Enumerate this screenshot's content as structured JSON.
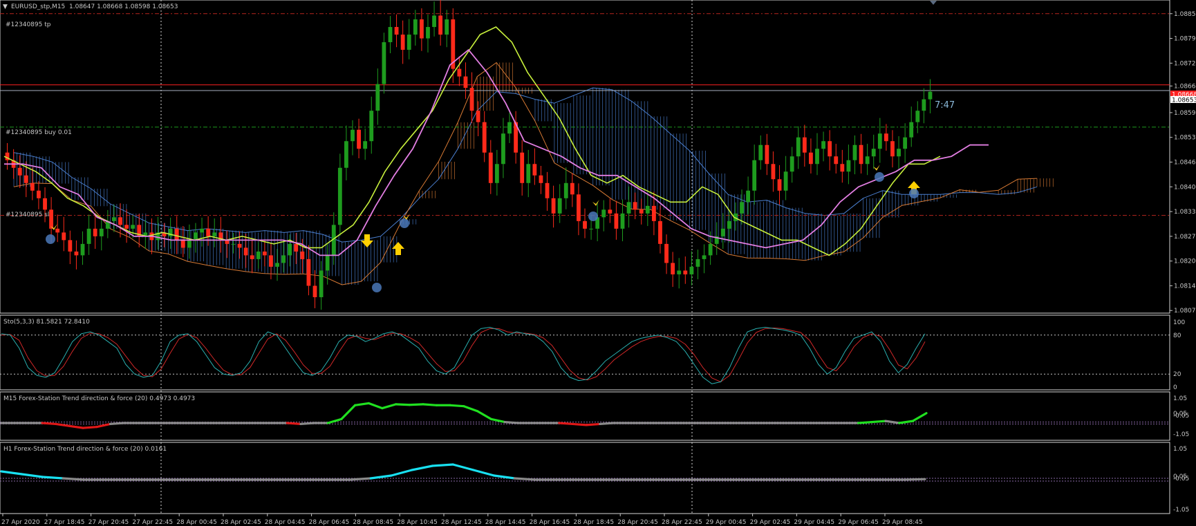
{
  "window": {
    "symbol_title": "EURUSD_stp,M15",
    "ohlc": "1.08647 1.08668 1.08598 1.08653",
    "countdown": "7:47"
  },
  "orders": {
    "tp_label": "#12340895 tp",
    "tp_price": 1.08855,
    "buy_label": "#12340895 buy 0.01",
    "buy_price": 1.08557,
    "sl_label": "#12340895 sl",
    "sl_price": 1.08325
  },
  "price_lines": {
    "ask_price": 1.08668,
    "ask_label": "1.08668",
    "bid_price": 1.08653,
    "bid_label": "1.08653"
  },
  "colors": {
    "bull": "#1e9c1e",
    "bear": "#ff2a1a",
    "tenkan": "#c8f03c",
    "kijun": "#e27ee2",
    "cloud_up": "#4a7fd0",
    "cloud_down": "#d87a34",
    "tp_line": "#b8261e",
    "buy_line": "#1e9c1e",
    "ask_line": "#ff2020",
    "bid_line": "#a8b0c0",
    "sto_main": "#2ab0b0",
    "sto_signal": "#d02828",
    "trend_up": "#20e020",
    "trend_down": "#e01818",
    "trend_flat": "#8a8a8a",
    "h1_up": "#18e0f0",
    "grid": "#c8c8c8"
  },
  "price_axis": {
    "min": 1.0807,
    "max": 1.0888,
    "tick_labels": [
      "1.08855",
      "1.08790",
      "1.08725",
      "1.08665",
      "1.08595",
      "1.08530",
      "1.08465",
      "1.08400",
      "1.08335",
      "1.08270",
      "1.08205",
      "1.08140",
      "1.08075"
    ]
  },
  "time_axis": {
    "labels": [
      "27 Apr 2020",
      "27 Apr 18:45",
      "27 Apr 20:45",
      "27 Apr 22:45",
      "28 Apr 00:45",
      "28 Apr 02:45",
      "28 Apr 04:45",
      "28 Apr 06:45",
      "28 Apr 08:45",
      "28 Apr 10:45",
      "28 Apr 12:45",
      "28 Apr 14:45",
      "28 Apr 16:45",
      "28 Apr 18:45",
      "28 Apr 20:45",
      "28 Apr 22:45",
      "29 Apr 00:45",
      "29 Apr 02:45",
      "29 Apr 04:45",
      "29 Apr 06:45",
      "29 Apr 08:45"
    ]
  },
  "stochastic": {
    "title": "Sto(5,3,3) 81.5821 72.8410",
    "ticks": [
      "100",
      "80",
      "20",
      "0"
    ],
    "levels": [
      80,
      20
    ]
  },
  "trend_m15": {
    "title": "M15 Forex-Station Trend direction & force (20) 0.4973 0.4973",
    "ticks": [
      "1.05",
      "0.05",
      "-0.05",
      "-1.05"
    ]
  },
  "trend_h1": {
    "title": "H1 Forex-Station Trend direction & force (20) 0.0161",
    "ticks": [
      "1.05",
      "0.05",
      "-0.05",
      "-1.05"
    ]
  },
  "chart_data": [
    {
      "type": "candlestick",
      "title": "EURUSD_stp,M15",
      "ylim": [
        1.0807,
        1.0888
      ],
      "x_range": [
        "27 Apr 2020",
        "29 Apr 09:30"
      ],
      "candles_close": [
        1.0847,
        1.0845,
        1.0843,
        1.0841,
        1.0839,
        1.0837,
        1.0834,
        1.0829,
        1.0828,
        1.0826,
        1.0823,
        1.0822,
        1.0825,
        1.0829,
        1.0827,
        1.0829,
        1.0831,
        1.0832,
        1.083,
        1.0829,
        1.083,
        1.0827,
        1.0828,
        1.0826,
        1.0828,
        1.0827,
        1.0829,
        1.0826,
        1.0824,
        1.0826,
        1.0828,
        1.0829,
        1.0827,
        1.0828,
        1.0826,
        1.0825,
        1.0825,
        1.0824,
        1.0822,
        1.0821,
        1.0823,
        1.0822,
        1.0819,
        1.082,
        1.0822,
        1.0825,
        1.0823,
        1.0821,
        1.0814,
        1.0811,
        1.0818,
        1.0822,
        1.083,
        1.0845,
        1.0852,
        1.0855,
        1.085,
        1.0852,
        1.086,
        1.0867,
        1.0878,
        1.0882,
        1.088,
        1.0876,
        1.088,
        1.0884,
        1.0879,
        1.0882,
        1.0885,
        1.088,
        1.0884,
        1.0871,
        1.0869,
        1.0866,
        1.086,
        1.0857,
        1.0849,
        1.0841,
        1.0846,
        1.0854,
        1.0857,
        1.0849,
        1.0841,
        1.0846,
        1.0843,
        1.0841,
        1.0837,
        1.0833,
        1.0837,
        1.0841,
        1.0838,
        1.0831,
        1.0829,
        1.0829,
        1.0832,
        1.0834,
        1.0833,
        1.0829,
        1.0833,
        1.0836,
        1.0834,
        1.0833,
        1.0835,
        1.0831,
        1.0825,
        1.082,
        1.0817,
        1.0818,
        1.0817,
        1.0819,
        1.0821,
        1.0822,
        1.0825,
        1.0827,
        1.0829,
        1.0831,
        1.0833,
        1.0836,
        1.0839,
        1.0847,
        1.0851,
        1.0846,
        1.0842,
        1.0839,
        1.0844,
        1.0848,
        1.0853,
        1.0849,
        1.0846,
        1.085,
        1.0852,
        1.0848,
        1.0846,
        1.0844,
        1.0847,
        1.0851,
        1.0846,
        1.0848,
        1.085,
        1.0854,
        1.0852,
        1.0848,
        1.085,
        1.0853,
        1.0857,
        1.086,
        1.0863,
        1.0865
      ],
      "ichimoku": {
        "tenkan": [
          1.0848,
          1.0846,
          1.0844,
          1.0841,
          1.0837,
          1.0835,
          1.0832,
          1.083,
          1.0828,
          1.0827,
          1.0828,
          1.0827,
          1.0826,
          1.0827,
          1.0826,
          1.0827,
          1.0826,
          1.0825,
          1.0826,
          1.0824,
          1.0824,
          1.0827,
          1.083,
          1.0836,
          1.0844,
          1.085,
          1.0855,
          1.086,
          1.0868,
          1.0874,
          1.088,
          1.0882,
          1.0878,
          1.087,
          1.0864,
          1.0858,
          1.085,
          1.0843,
          1.0841,
          1.0843,
          1.084,
          1.0838,
          1.0836,
          1.0836,
          1.084,
          1.0838,
          1.0832,
          1.083,
          1.0828,
          1.0826,
          1.0826,
          1.0824,
          1.0822,
          1.0825,
          1.0829,
          1.0835,
          1.0841,
          1.0846,
          1.0846,
          1.0848
        ],
        "kijun": [
          1.0846,
          1.0846,
          1.0845,
          1.084,
          1.0838,
          1.0832,
          1.083,
          1.0827,
          1.0827,
          1.0826,
          1.0826,
          1.0826,
          1.0826,
          1.0826,
          1.0826,
          1.0826,
          1.0825,
          1.0822,
          1.0822,
          1.0826,
          1.0835,
          1.0843,
          1.085,
          1.086,
          1.0872,
          1.0876,
          1.087,
          1.0862,
          1.0852,
          1.085,
          1.0848,
          1.0845,
          1.0843,
          1.0843,
          1.084,
          1.0837,
          1.0833,
          1.0829,
          1.0827,
          1.0826,
          1.0825,
          1.0824,
          1.0825,
          1.0826,
          1.083,
          1.0836,
          1.084,
          1.0842,
          1.0844,
          1.0847,
          1.0847,
          1.0848,
          1.0851,
          1.0851
        ]
      }
    },
    {
      "type": "line",
      "title": "Sto(5,3,3) 81.5821 72.8410",
      "ylim": [
        0,
        100
      ],
      "series": [
        {
          "name": "Sto(5,3,3)",
          "values": [
            82,
            80,
            60,
            30,
            18,
            15,
            22,
            45,
            70,
            82,
            85,
            80,
            70,
            60,
            35,
            20,
            15,
            18,
            40,
            70,
            80,
            82,
            70,
            50,
            30,
            20,
            18,
            22,
            40,
            70,
            85,
            80,
            60,
            40,
            22,
            18,
            25,
            45,
            70,
            80,
            78,
            70,
            75,
            82,
            85,
            80,
            70,
            60,
            40,
            25,
            20,
            30,
            55,
            80,
            90,
            92,
            88,
            80,
            85,
            82,
            80,
            70,
            55,
            30,
            15,
            10,
            12,
            25,
            40,
            50,
            60,
            70,
            75,
            78,
            80,
            76,
            70,
            55,
            35,
            15,
            5,
            8,
            30,
            60,
            85,
            90,
            92,
            90,
            88,
            85,
            80,
            60,
            35,
            20,
            30,
            55,
            75,
            80,
            85,
            70,
            40,
            22,
            35,
            60,
            82
          ]
        },
        {
          "name": "signal",
          "values": [
            80,
            81,
            72,
            45,
            25,
            17,
            18,
            32,
            55,
            75,
            83,
            82,
            76,
            66,
            48,
            30,
            18,
            16,
            28,
            52,
            74,
            81,
            76,
            60,
            42,
            26,
            19,
            19,
            30,
            52,
            74,
            82,
            72,
            54,
            34,
            21,
            21,
            32,
            54,
            74,
            79,
            75,
            73,
            78,
            83,
            82,
            76,
            68,
            52,
            36,
            24,
            25,
            40,
            64,
            84,
            90,
            90,
            85,
            83,
            83,
            81,
            76,
            64,
            45,
            26,
            14,
            11,
            16,
            28,
            42,
            52,
            62,
            70,
            75,
            78,
            78,
            75,
            66,
            50,
            30,
            14,
            8,
            18,
            42,
            68,
            84,
            90,
            91,
            90,
            87,
            84,
            72,
            50,
            30,
            25,
            40,
            62,
            76,
            82,
            78,
            58,
            34,
            28,
            45,
            70
          ]
        }
      ]
    },
    {
      "type": "line",
      "title": "M15 Forex-Station Trend direction & force (20) 0.4973 0.4973",
      "ylim": [
        -1.05,
        1.05
      ],
      "series": [
        {
          "name": "M15 Trend direction & force (20)",
          "values": [
            0,
            0,
            0,
            0,
            -0.05,
            -0.15,
            -0.25,
            -0.2,
            -0.05,
            0,
            0,
            0,
            0,
            0,
            0,
            0,
            0,
            0,
            0,
            0,
            0,
            0,
            -0.05,
            0,
            0,
            0.2,
            0.9,
            1.0,
            0.75,
            0.95,
            0.92,
            0.95,
            0.9,
            0.9,
            0.85,
            0.6,
            0.2,
            0.05,
            0,
            0,
            0,
            0,
            -0.05,
            -0.1,
            -0.05,
            0,
            0,
            0,
            0,
            0,
            0,
            0,
            0,
            0,
            0,
            0,
            0,
            0,
            0,
            0,
            0,
            0,
            0,
            0,
            0.05,
            0.1,
            0,
            0.1,
            0.5
          ]
        }
      ]
    },
    {
      "type": "line",
      "title": "H1 Forex-Station Trend direction & force (20) 0.0161",
      "ylim": [
        -1.05,
        1.05
      ],
      "series": [
        {
          "name": "H1 Trend direction & force (20)",
          "values": [
            0.3,
            0.2,
            0.1,
            0.05,
            0,
            0,
            0,
            0,
            0,
            0,
            0,
            0,
            0,
            0,
            0,
            0,
            0,
            0,
            0.05,
            0.15,
            0.35,
            0.5,
            0.55,
            0.35,
            0.15,
            0.05,
            0,
            0,
            0,
            0,
            0,
            0,
            0,
            0,
            0,
            0,
            0,
            0,
            0,
            0,
            0,
            0,
            0,
            0,
            0,
            0.02
          ]
        }
      ]
    }
  ]
}
